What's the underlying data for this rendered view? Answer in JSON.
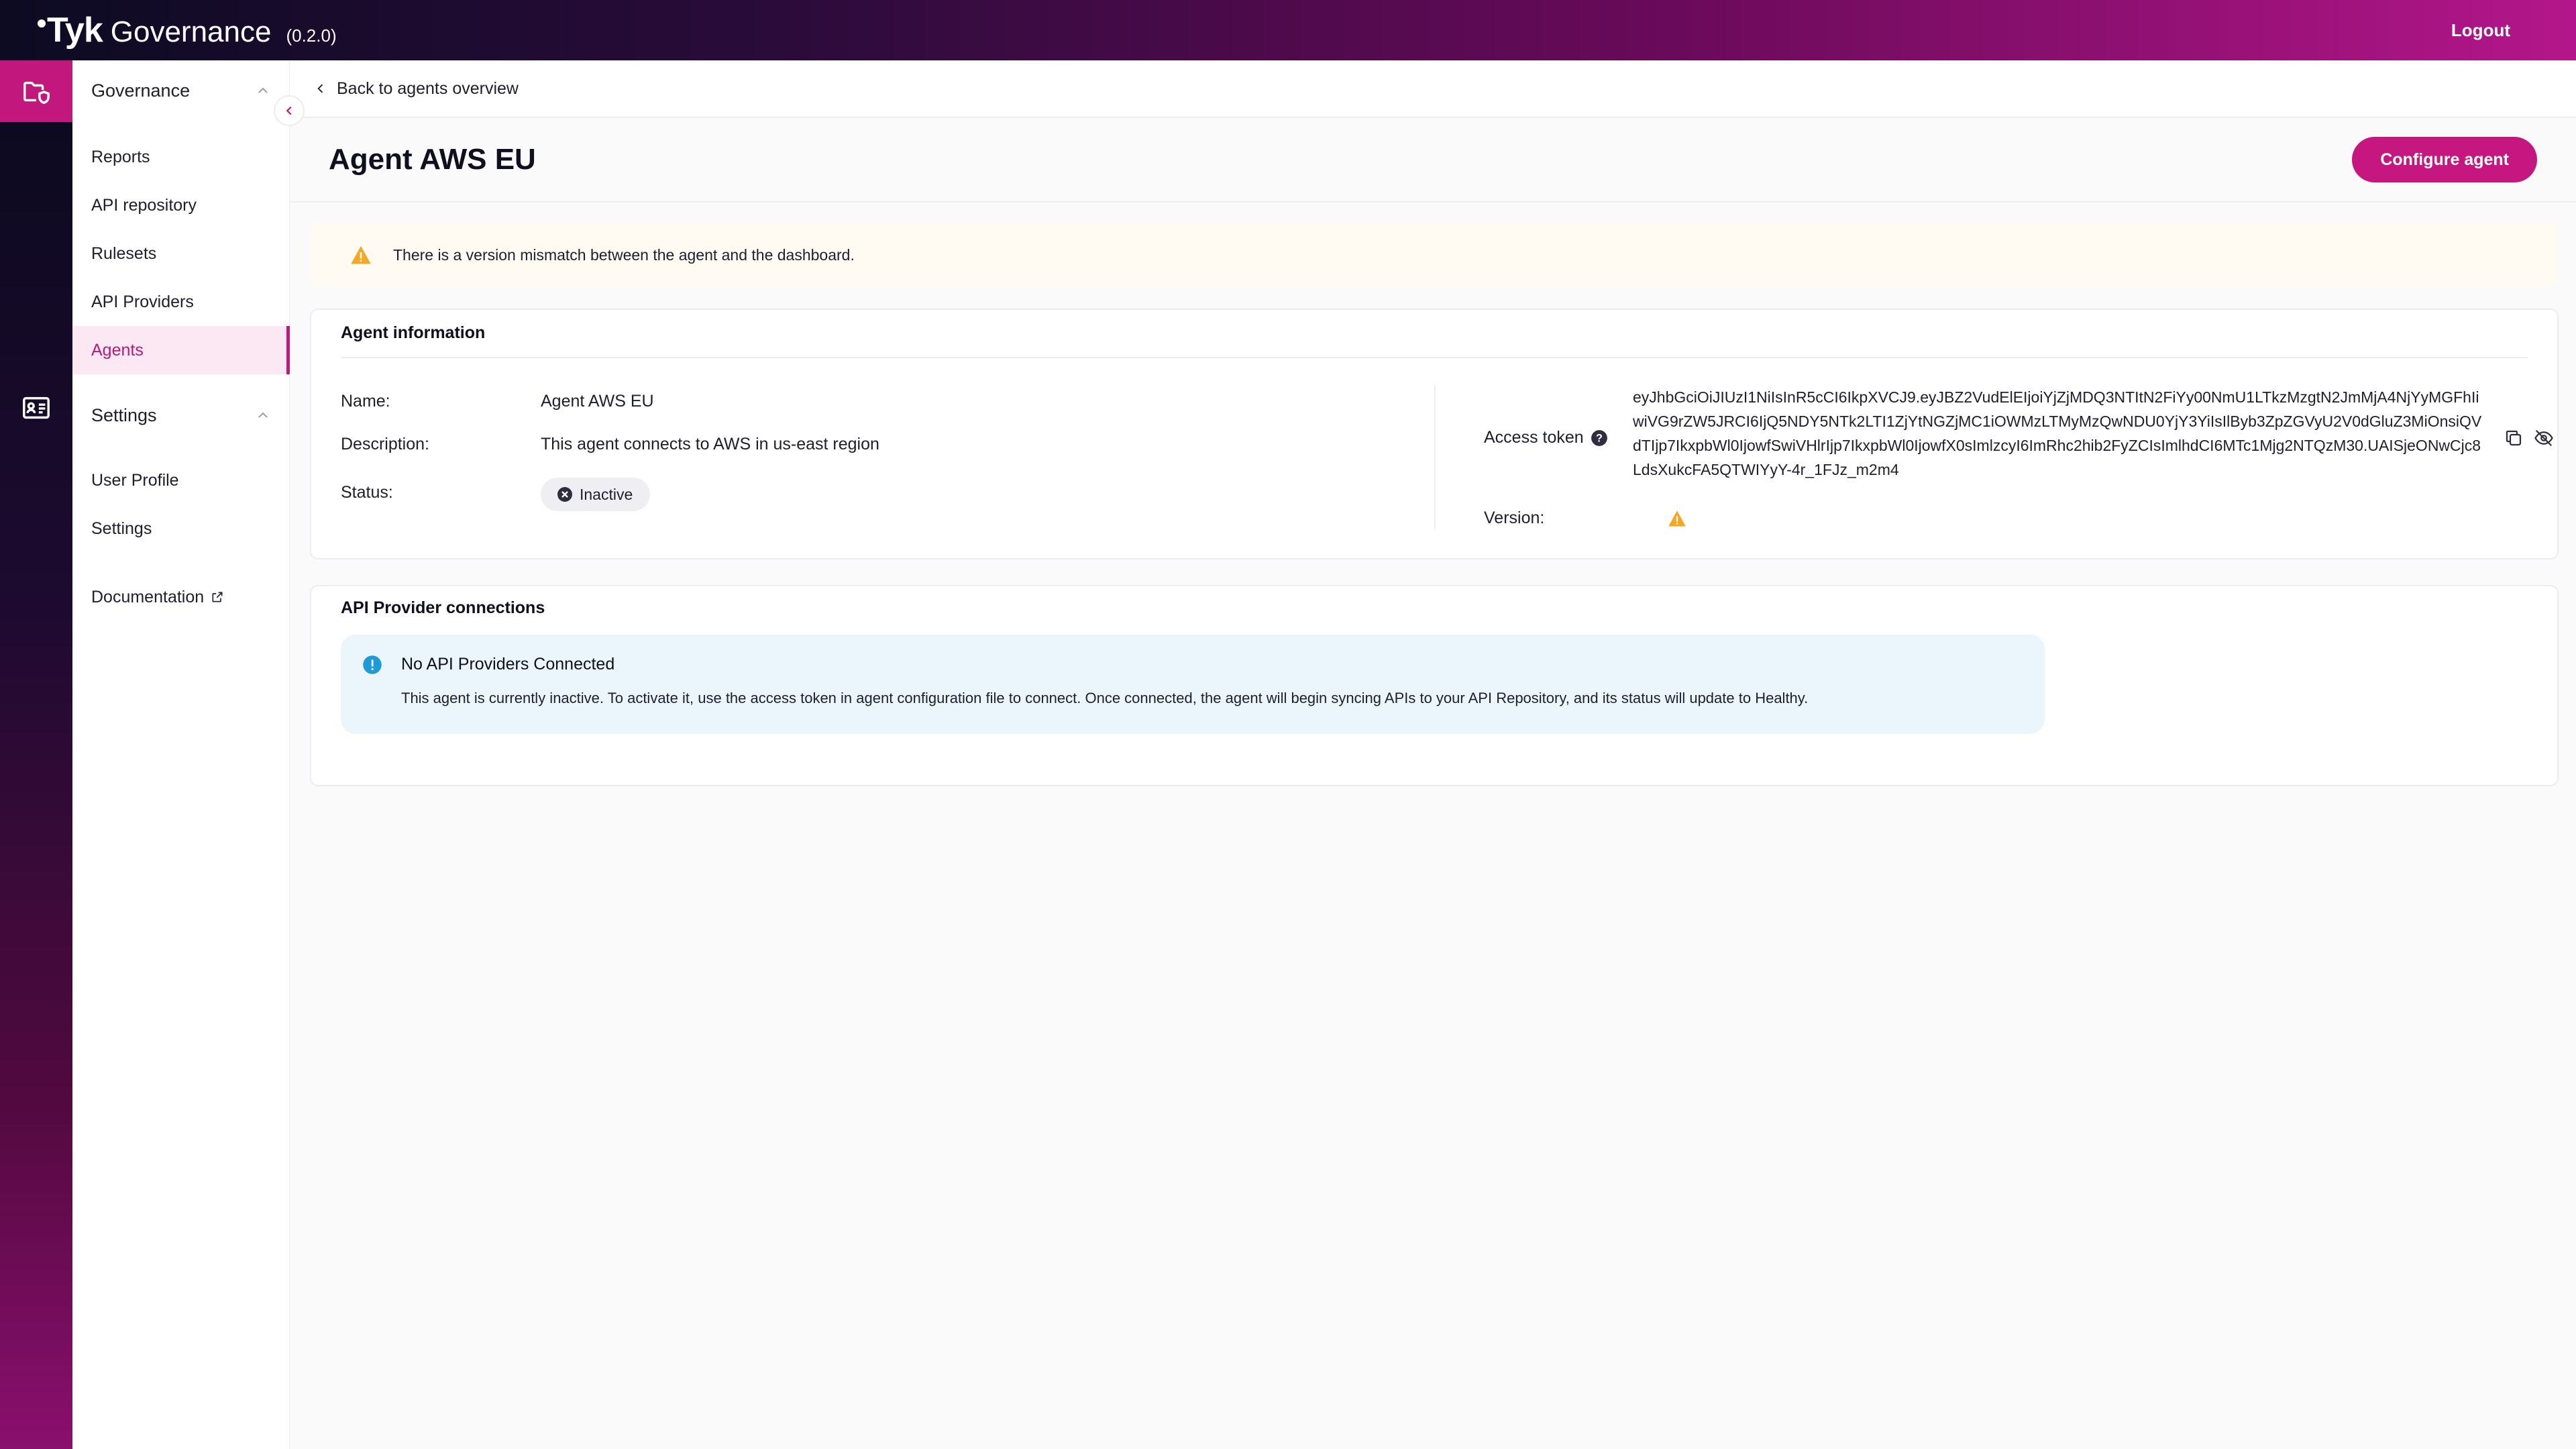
{
  "app": {
    "logo": "Tyk",
    "product": "Governance",
    "version": "(0.2.0)",
    "logout_label": "Logout"
  },
  "rail": {
    "items": [
      {
        "icon": "governance-folder-shield-icon",
        "active": true
      },
      {
        "icon": "id-card-icon",
        "active": false
      }
    ]
  },
  "sidebar": {
    "governance_section": "Governance",
    "governance_items": [
      "Reports",
      "API repository",
      "Rulesets",
      "API Providers",
      "Agents"
    ],
    "settings_section": "Settings",
    "settings_items": [
      "User Profile",
      "Settings"
    ],
    "documentation_label": "Documentation",
    "active_item": "Agents"
  },
  "breadcrumb": {
    "back_label": "Back to agents overview"
  },
  "page": {
    "title": "Agent AWS EU",
    "configure_button": "Configure agent"
  },
  "warning": {
    "text": "There is a version mismatch between the agent and the dashboard.",
    "color": "#f5a623"
  },
  "agent_info": {
    "title": "Agent information",
    "name_label": "Name:",
    "name_value": "Agent AWS EU",
    "description_label": "Description:",
    "description_value": "This agent connects to AWS in us-east region",
    "status_label": "Status:",
    "status_value": "Inactive",
    "access_token_label": "Access token",
    "access_token_value": "eyJhbGciOiJIUzI1NiIsInR5cCI6IkpXVCJ9.eyJBZ2VudElEIjoiYjZjMDQ3NTItN2FiYy00NmU1LTkzMzgtN2JmMjA4NjYyMGFhIiwiVG9rZW5JRCI6IjQ5NDY5NTk2LTI1ZjYtNGZjMC1iOWMzLTMyMzQwNDU0YjY3YiIsIlByb3ZpZGVyU2V0dGluZ3MiOnsiQVdTIjp7IkxpbWl0IjowfSwiVHlrIjp7IkxpbWl0IjowfX0sImlzcyI6ImRhc2hib2FyZCIsImlhdCI6MTc1Mjg2NTQzM30.UAISjeONwCjc8LdsXukcFA5QTWIYyY-4r_1FJz_m2m4",
    "version_label": "Version:"
  },
  "connections": {
    "title": "API Provider connections",
    "callout_title": "No API Providers Connected",
    "callout_text": "This agent is currently inactive. To activate it, use the access token in agent configuration file to connect. Once connected, the agent will begin syncing APIs to your API Repository, and its status will update to Healthy.",
    "info_color": "#1e9ad6"
  },
  "colors": {
    "accent": "#c5177f",
    "active_bg": "#fbe8f3"
  }
}
